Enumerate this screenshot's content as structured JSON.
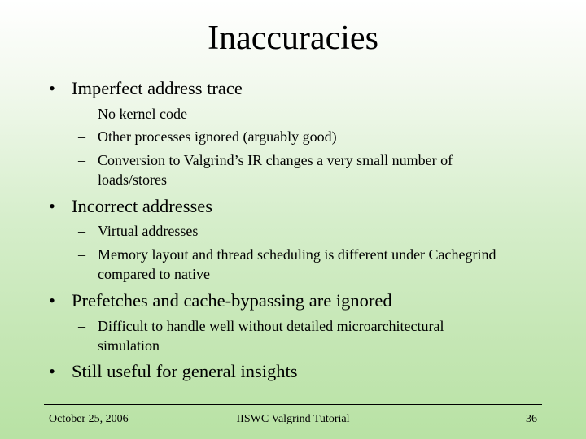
{
  "slide": {
    "title": "Inaccuracies",
    "bullet_glyph": "•",
    "dash_glyph": "–",
    "bullets": [
      {
        "text": "Imperfect address trace",
        "subs": [
          "No kernel code",
          "Other processes ignored (arguably good)",
          "Conversion to Valgrind’s IR changes a very small number of loads/stores"
        ]
      },
      {
        "text": "Incorrect addresses",
        "subs": [
          "Virtual addresses",
          "Memory layout and thread scheduling is different under Cachegrind compared to native"
        ]
      },
      {
        "text": "Prefetches and cache-bypassing are ignored",
        "subs": [
          "Difficult to handle well without detailed microarchitectural simulation"
        ]
      },
      {
        "text": "Still useful for general insights",
        "subs": []
      }
    ]
  },
  "footer": {
    "date": "October 25, 2006",
    "event": "IISWC Valgrind Tutorial",
    "page_number": "36"
  },
  "colors": {
    "background_top": "#ffffff",
    "background_bottom": "#b8e2a4",
    "text": "#000000"
  }
}
